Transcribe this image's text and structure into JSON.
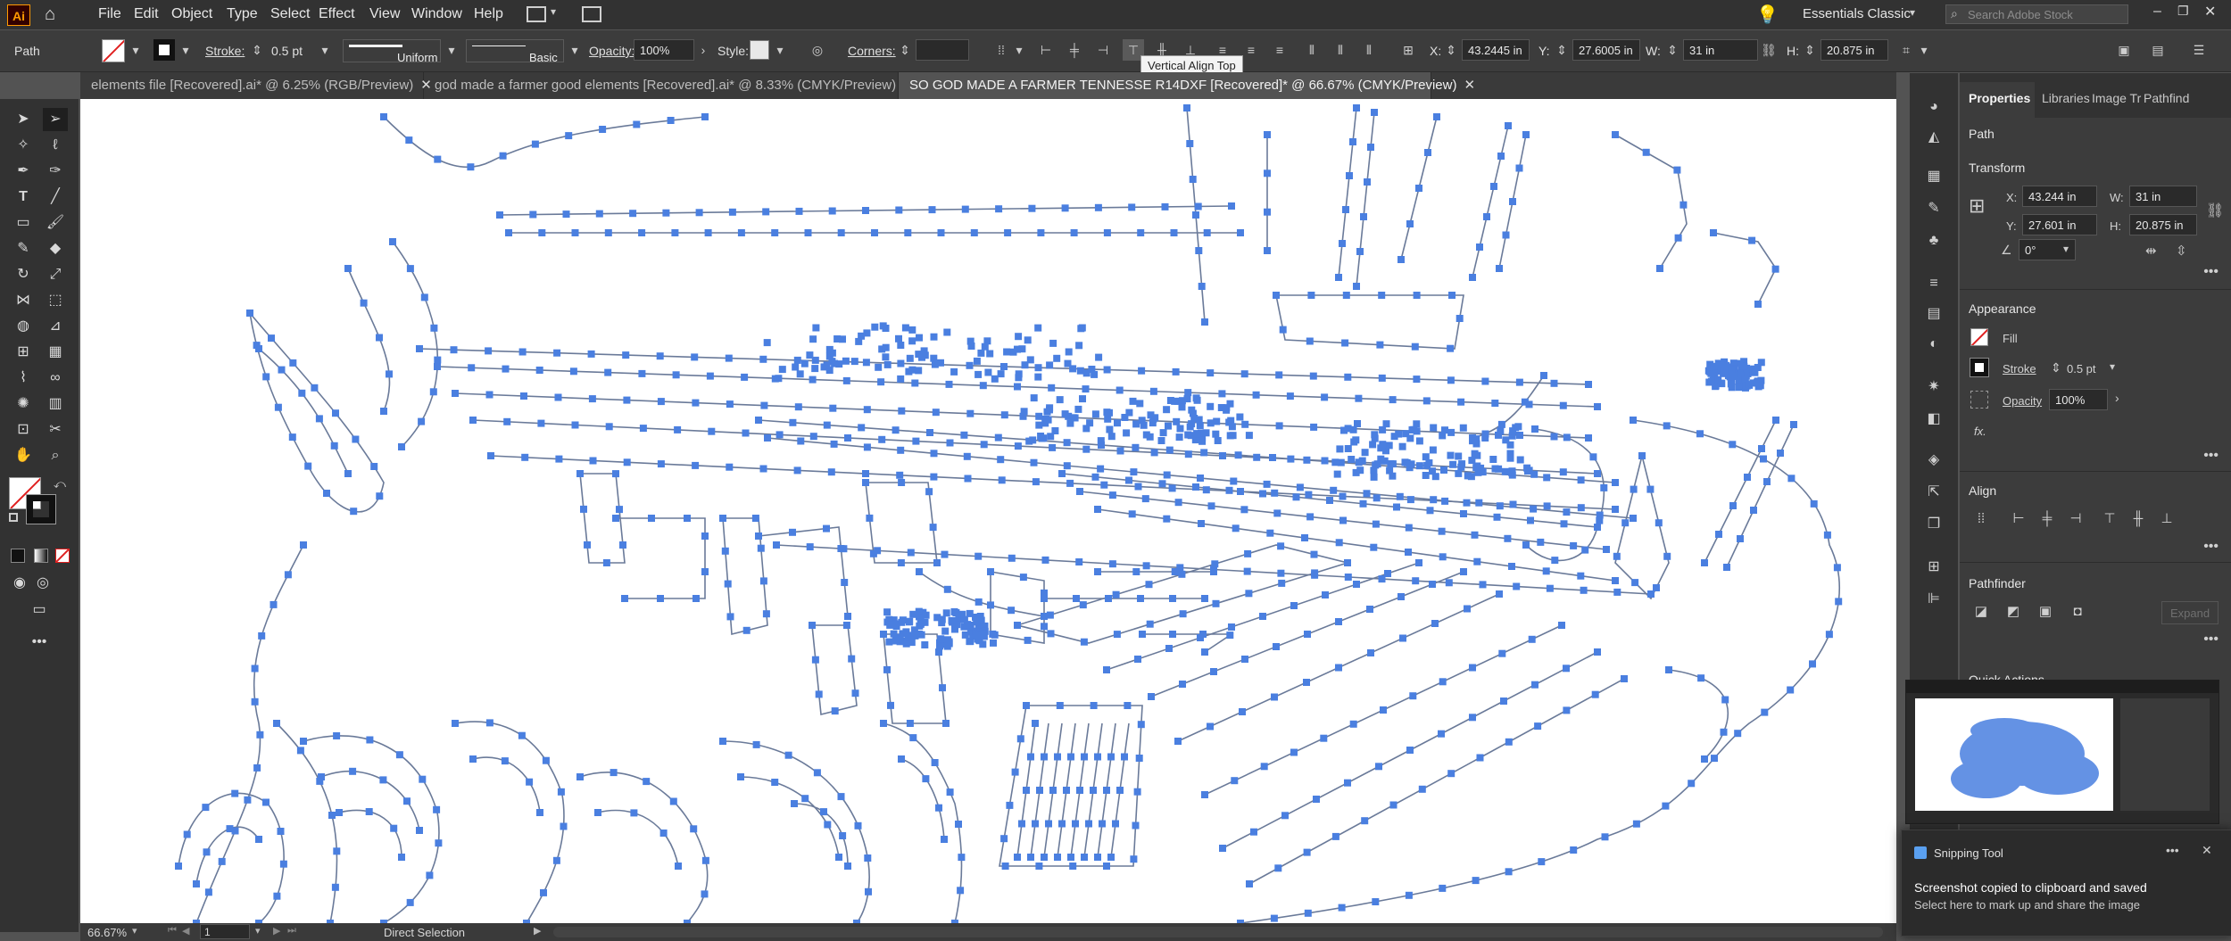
{
  "app": {
    "logo": "Ai",
    "workspace": "Essentials Classic",
    "search_placeholder": "Search Adobe Stock"
  },
  "menu": [
    "File",
    "Edit",
    "Object",
    "Type",
    "Select",
    "Effect",
    "View",
    "Window",
    "Help"
  ],
  "control": {
    "selection_type": "Path",
    "stroke_label": "Stroke:",
    "stroke_value": "0.5 pt",
    "profile_uniform": "Uniform",
    "brush_basic": "Basic",
    "opacity_label": "Opacity:",
    "opacity_value": "100%",
    "style_label": "Style:",
    "corners_label": "Corners:",
    "x_label": "X:",
    "x_value": "43.2445 in",
    "y_label": "Y:",
    "y_value": "27.6005 in",
    "w_label": "W:",
    "w_value": "31 in",
    "h_label": "H:",
    "h_value": "20.875 in"
  },
  "tooltip": "Vertical Align Top",
  "tabs": [
    {
      "label": "elements file [Recovered].ai* @ 6.25% (RGB/Preview)",
      "active": false
    },
    {
      "label": "god made a farmer good elements [Recovered].ai* @ 8.33% (CMYK/Preview)",
      "active": false
    },
    {
      "label": "SO GOD MADE A FARMER TENNESSE R14DXF [Recovered]* @ 66.67% (CMYK/Preview)",
      "active": true
    }
  ],
  "panel": {
    "tabs": [
      "Properties",
      "Libraries",
      "Image Tr",
      "Pathfind"
    ],
    "selection": "Path",
    "transform_title": "Transform",
    "x_label": "X:",
    "x_value": "43.244 in",
    "y_label": "Y:",
    "y_value": "27.601 in",
    "w_label": "W:",
    "w_value": "31 in",
    "h_label": "H:",
    "h_value": "20.875 in",
    "angle_value": "0°",
    "appearance_title": "Appearance",
    "fill_label": "Fill",
    "stroke_label": "Stroke",
    "stroke_value": "0.5 pt",
    "opacity_label": "Opacity",
    "opacity_value": "100%",
    "fx_label": "fx.",
    "align_title": "Align",
    "pathfinder_title": "Pathfinder",
    "expand_label": "Expand",
    "quick_actions_title": "Quick Actions"
  },
  "status": {
    "zoom": "66.67%",
    "artboard": "1",
    "tool": "Direct Selection"
  },
  "toast": {
    "app": "Snipping Tool",
    "title": "Screenshot copied to clipboard and saved",
    "body": "Select here to mark up and share the image"
  },
  "colors": {
    "anchor": "#4a7fe0",
    "path": "#5a6a86",
    "accent": "#f0a020"
  }
}
